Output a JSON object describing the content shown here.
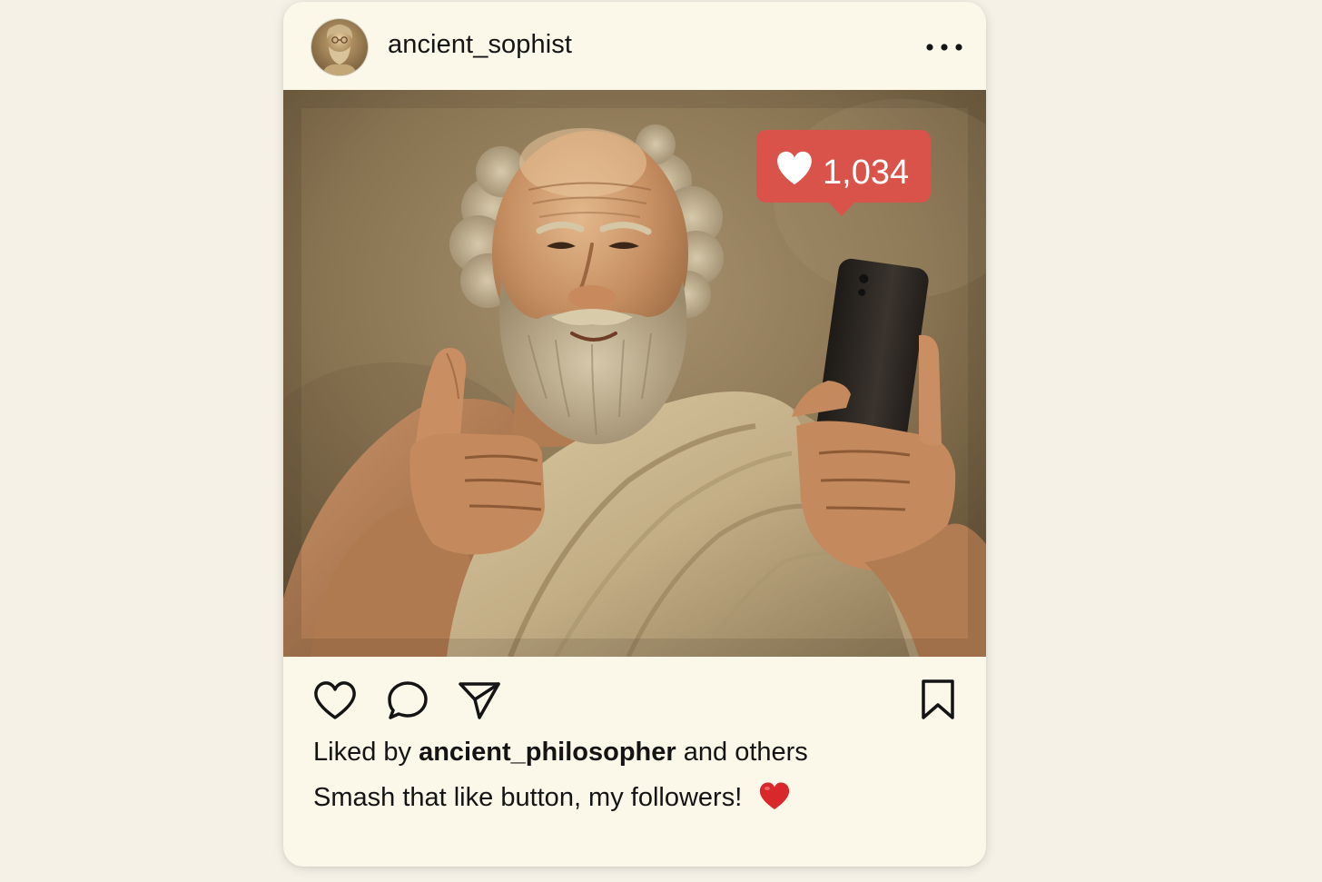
{
  "post": {
    "username": "ancient_sophist",
    "more_icon": "more-horizontal-icon",
    "photo": {
      "subject": "bearded-man-toga-thumbs-up-holding-phone",
      "like_notification": {
        "icon": "heart-icon",
        "count": "1,034",
        "color": "#d9534a"
      }
    },
    "actions": {
      "like_icon": "heart-outline-icon",
      "comment_icon": "comment-icon",
      "share_icon": "send-icon",
      "save_icon": "bookmark-icon"
    },
    "likes": {
      "prefix": "Liked by",
      "user": "ancient_philosopher",
      "suffix": "and others"
    },
    "caption": {
      "text": "Smash that like button, my followers!",
      "emoji": "red-heart-emoji",
      "emoji_color": "#d8282b"
    }
  },
  "colors": {
    "page_background": "#f5f1e6",
    "card_background": "#fcf8e9",
    "text": "#141414"
  }
}
